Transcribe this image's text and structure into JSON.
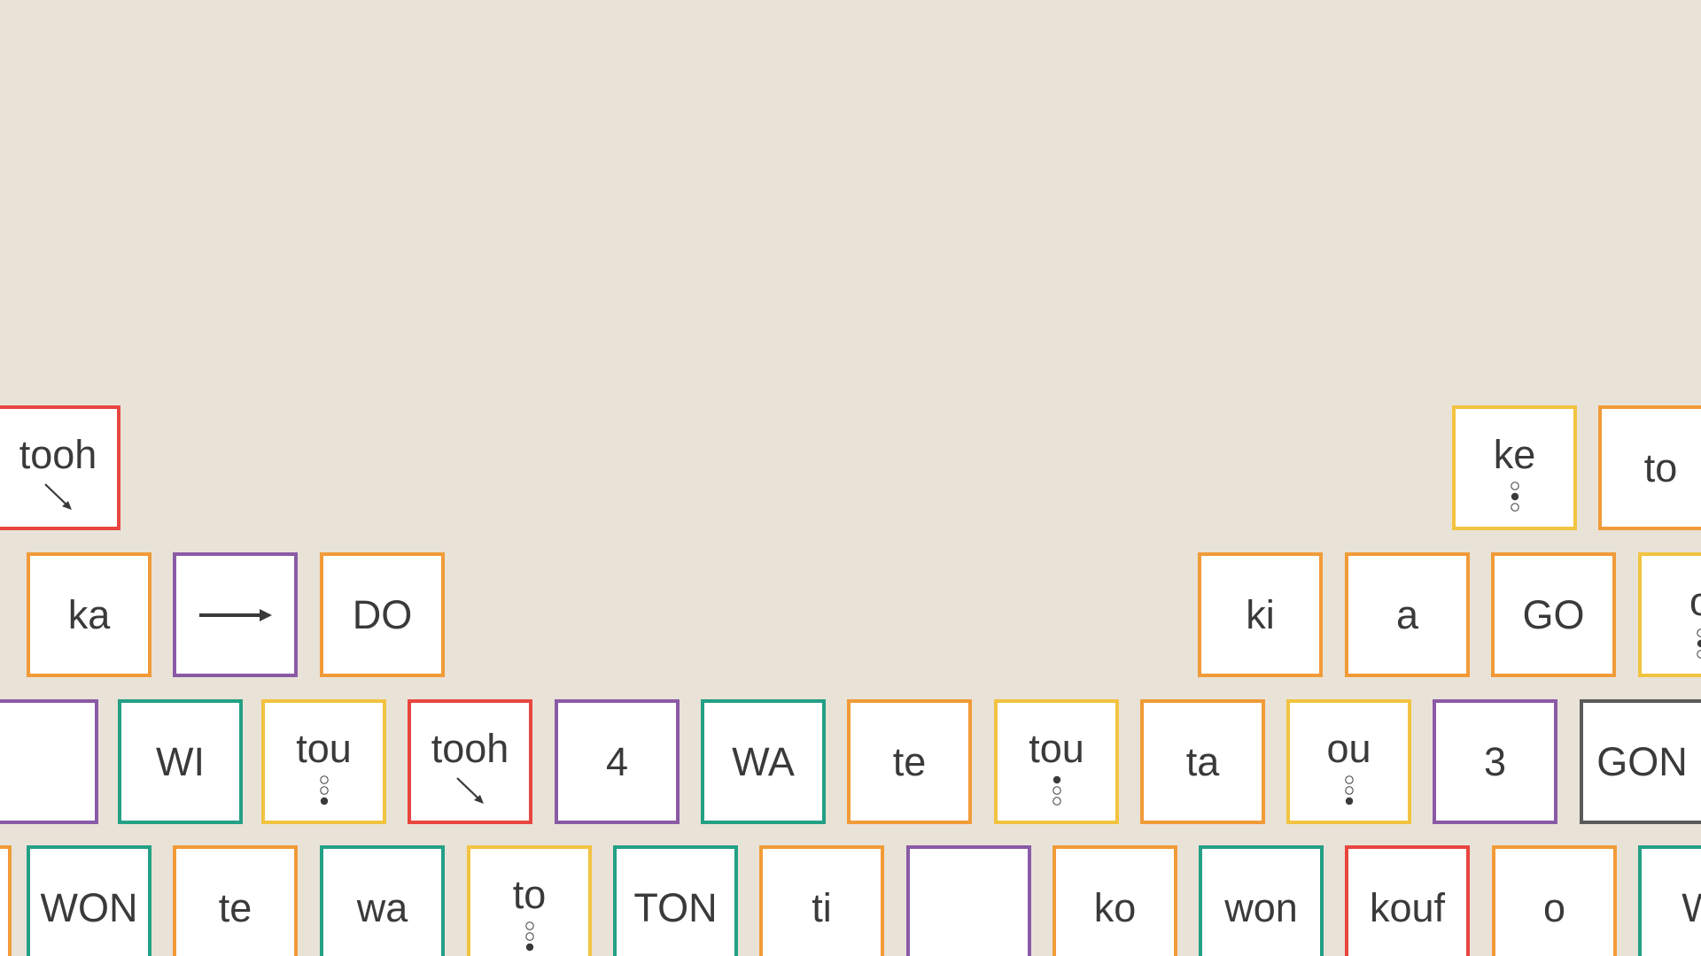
{
  "colors": {
    "background": "#e9e2d7",
    "red": "#e8463f",
    "orange": "#f19b38",
    "yellow": "#f2c340",
    "green": "#23a085",
    "purple": "#8a5aa6",
    "gray": "#5a5a5a",
    "text": "#3a3a3a"
  },
  "rows": [
    {
      "name": "row-1",
      "tiles": [
        {
          "text": "tooh",
          "color": "red",
          "mark": "falling-tone-arrow-icon"
        },
        {
          "text": "ke",
          "color": "yellow",
          "mark": "tone-dots-middle-icon"
        },
        {
          "text": "to",
          "color": "orange",
          "mark": ""
        }
      ]
    },
    {
      "name": "row-2",
      "tiles": [
        {
          "text": "ka",
          "color": "orange",
          "mark": ""
        },
        {
          "text": "",
          "color": "purple",
          "mark": "right-arrow-icon"
        },
        {
          "text": "DO",
          "color": "orange",
          "mark": ""
        },
        {
          "text": "ki",
          "color": "orange",
          "mark": ""
        },
        {
          "text": "a",
          "color": "orange",
          "mark": ""
        },
        {
          "text": "GO",
          "color": "orange",
          "mark": ""
        },
        {
          "text": "o",
          "color": "yellow",
          "mark": "tone-dots-icon"
        }
      ]
    },
    {
      "name": "row-3",
      "tiles": [
        {
          "text": "",
          "color": "purple",
          "mark": ""
        },
        {
          "text": "WI",
          "color": "green",
          "mark": ""
        },
        {
          "text": "tou",
          "color": "yellow",
          "mark": "tone-dots-bottom-icon"
        },
        {
          "text": "tooh",
          "color": "red",
          "mark": "falling-tone-arrow-icon"
        },
        {
          "text": "4",
          "color": "purple",
          "mark": ""
        },
        {
          "text": "WA",
          "color": "green",
          "mark": ""
        },
        {
          "text": "te",
          "color": "orange",
          "mark": ""
        },
        {
          "text": "tou",
          "color": "yellow",
          "mark": "tone-dots-top-icon"
        },
        {
          "text": "ta",
          "color": "orange",
          "mark": ""
        },
        {
          "text": "ou",
          "color": "yellow",
          "mark": "tone-dots-bottom-icon"
        },
        {
          "text": "3",
          "color": "purple",
          "mark": ""
        },
        {
          "text": "GON",
          "color": "gray",
          "mark": ""
        }
      ]
    },
    {
      "name": "row-4",
      "tiles": [
        {
          "text": "",
          "color": "orange",
          "mark": ""
        },
        {
          "text": "WON",
          "color": "green",
          "mark": ""
        },
        {
          "text": "te",
          "color": "orange",
          "mark": ""
        },
        {
          "text": "wa",
          "color": "green",
          "mark": ""
        },
        {
          "text": "to",
          "color": "yellow",
          "mark": "tone-dots-bottom-icon"
        },
        {
          "text": "TON",
          "color": "green",
          "mark": ""
        },
        {
          "text": "ti",
          "color": "orange",
          "mark": ""
        },
        {
          "text": "",
          "color": "purple",
          "mark": ""
        },
        {
          "text": "ko",
          "color": "orange",
          "mark": ""
        },
        {
          "text": "won",
          "color": "green",
          "mark": ""
        },
        {
          "text": "kouf",
          "color": "red",
          "mark": ""
        },
        {
          "text": "o",
          "color": "orange",
          "mark": ""
        },
        {
          "text": "W",
          "color": "green",
          "mark": ""
        }
      ]
    }
  ]
}
